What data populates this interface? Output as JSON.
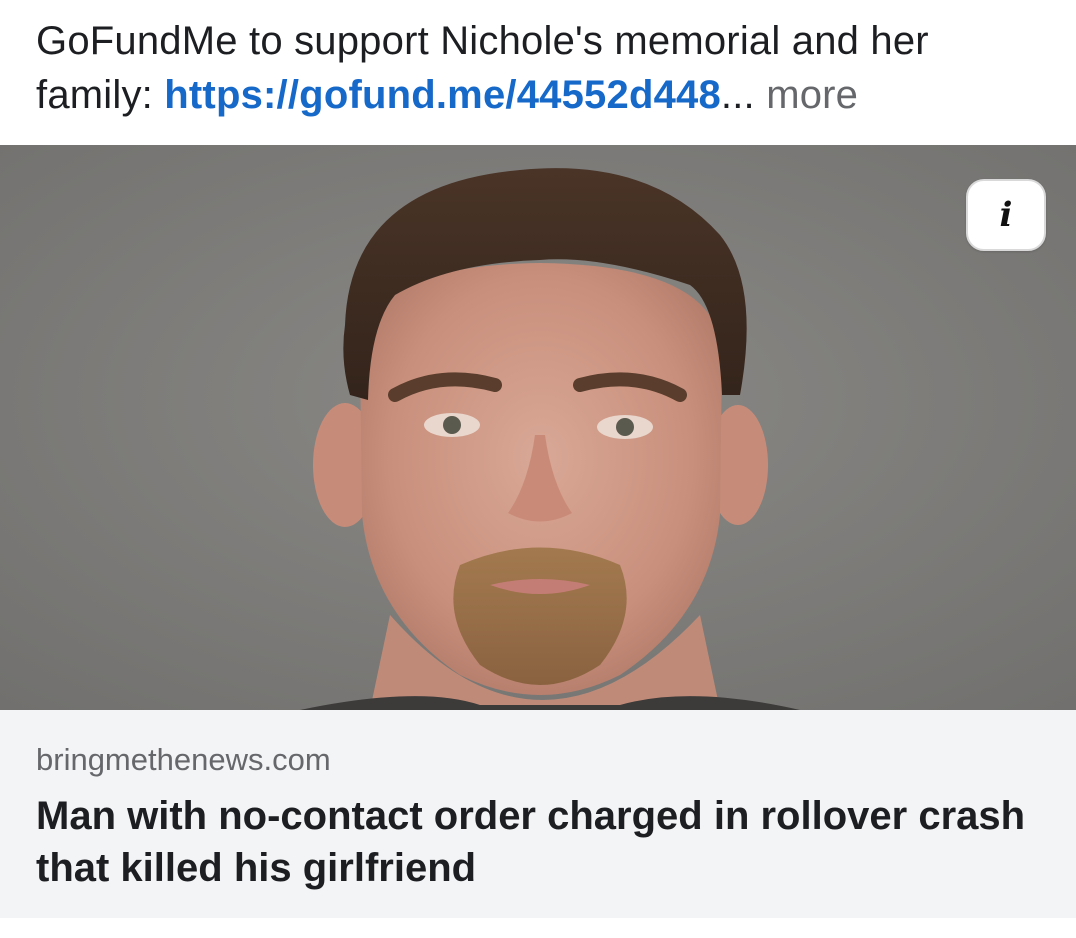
{
  "post": {
    "text_prefix": "GoFundMe to support Nichole's memorial and her family: ",
    "link_text": "https://gofund.me/44552d448",
    "ellipsis": "... ",
    "more_label": "more"
  },
  "link_card": {
    "image_alt_icon": "person-photo",
    "info_icon": "info-icon",
    "info_glyph": "i",
    "domain": "bringmethenews.com",
    "headline": "Man with no-contact order charged in rollover crash that killed his girlfriend"
  },
  "colors": {
    "link": "#1769c9",
    "text": "#1c1e21",
    "muted": "#65676b",
    "card_footer_bg": "#f3f4f6",
    "photo_bg": "#7b7a78"
  }
}
